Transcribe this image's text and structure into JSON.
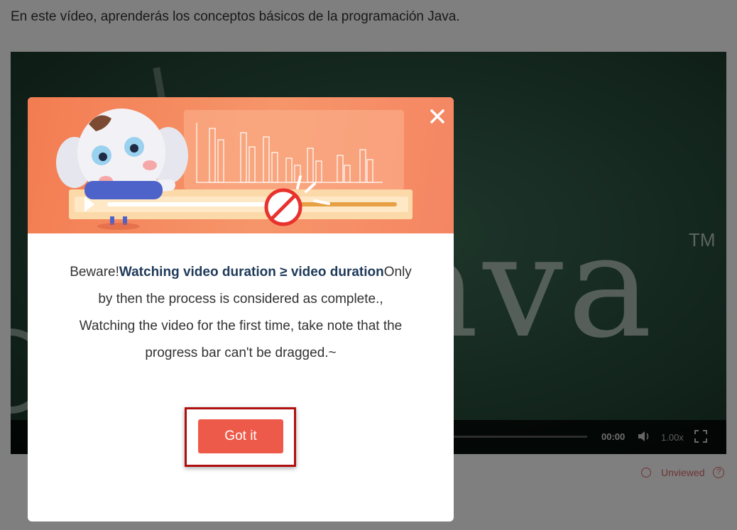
{
  "page": {
    "intro_text": "En este vídeo, aprenderás los conceptos básicos de la programación Java."
  },
  "video": {
    "board_text": "ava",
    "trademark": "TM",
    "time": "00:00",
    "speed": "1.00x",
    "icons": [
      "volume-icon",
      "fullscreen-icon"
    ]
  },
  "status": {
    "label": "Unviewed",
    "help_icon": "?"
  },
  "modal": {
    "close_icon": "close-icon",
    "message": {
      "prefix": "Beware!",
      "bold": "Watching video duration ≥ video duration",
      "suffix": "Only",
      "line2": "by then the process is considered as complete.,",
      "line3": "Watching the video for the first time, take note that the",
      "line4": "progress bar can't be dragged.~"
    },
    "button_label": "Got it"
  },
  "colors": {
    "accent": "#ee5a49",
    "header": "#f37c52",
    "highlight": "#b00f0f",
    "status": "#e06666"
  }
}
